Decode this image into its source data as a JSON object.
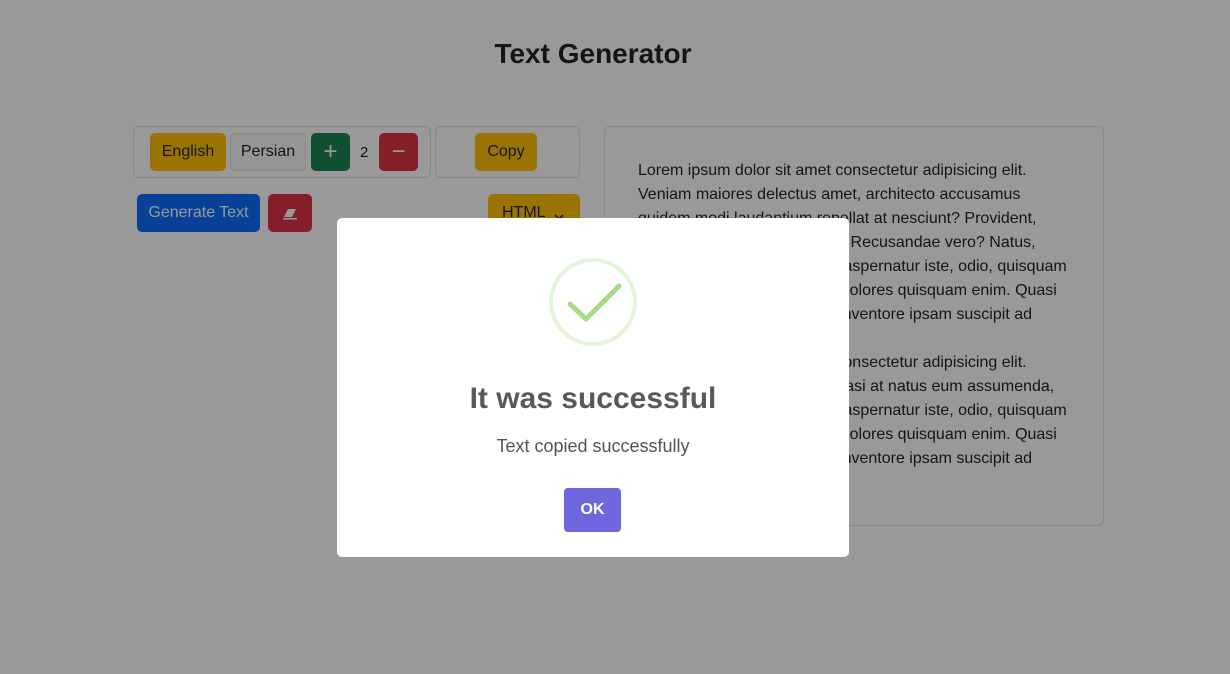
{
  "header": {
    "title": "Text Generator"
  },
  "toolbar": {
    "lang_english": "English",
    "lang_persian": "Persian",
    "plus": "+",
    "paragraph_count": "2",
    "minus": "−",
    "copy_label": "Copy",
    "generate_label": "Generate Text",
    "format_value": "HTML"
  },
  "output": {
    "paragraphs": [
      "Lorem ipsum dolor sit amet consectetur adipisicing elit. Veniam maiores delectus amet, architecto accusamus quidem modi laudantium repellat at nesciunt? Provident, quidem. Asperiores, nostrum. Recusandae vero? Natus, ducimus? Voluptate corporis aspernatur iste, odio, quisquam maiores doloribus molestias dolores quisquam enim. Quasi voluptatibus, at, quis aliquid inventore ipsam suscipit ad",
      "Lorem ipsum dolor sit amet consectetur adipisicing elit. Doloribus doloremque nisi quasi at natus eum assumenda, ducimus? Voluptate corporis aspernatur iste, odio, quisquam maiores doloribus molestias dolores quisquam enim. Quasi voluptatibus, at, quis aliquid inventore ipsam suscipit ad"
    ]
  },
  "modal": {
    "title": "It was successful",
    "text": "Text copied successfully",
    "ok_label": "OK"
  },
  "icons": {
    "eraser": "eraser-icon",
    "chevron": "chevron-down-icon",
    "success": "check-icon"
  },
  "colors": {
    "warning": "#ffc107",
    "success": "#198754",
    "danger": "#dc3545",
    "primary": "#0d6efd",
    "modal_button": "#7066e0",
    "check": "#a5dc86"
  }
}
